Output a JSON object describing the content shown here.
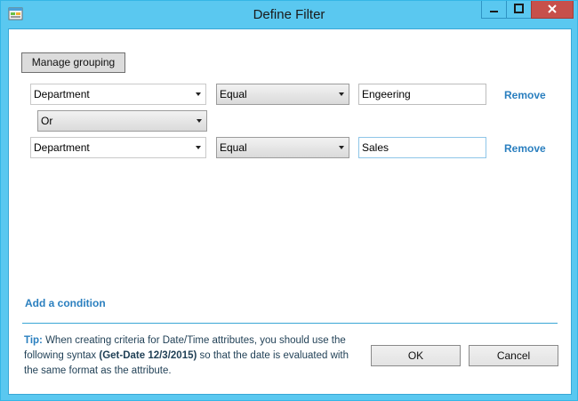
{
  "window": {
    "title": "Define Filter",
    "icon": "filter-app-icon",
    "controls": [
      "minimize-icon",
      "maximize-icon",
      "close-icon"
    ]
  },
  "toolbar": {
    "manage_grouping_label": "Manage grouping"
  },
  "conditions": [
    {
      "attribute": "Department",
      "operator": "Equal",
      "value": "Engeering",
      "remove_label": "Remove"
    },
    {
      "attribute": "Department",
      "operator": "Equal",
      "value": "Sales",
      "remove_label": "Remove"
    }
  ],
  "group_operator": "Or",
  "add_condition_label": "Add a condition",
  "tip": {
    "label": "Tip:",
    "text_before": " When creating criteria for Date/Time attributes, you should use the following syntax ",
    "syntax": "(Get-Date 12/3/2015)",
    "text_after": " so that the date is evaluated with the same format as the attribute."
  },
  "footer": {
    "ok_label": "OK",
    "cancel_label": "Cancel"
  },
  "colors": {
    "titlebar": "#5ac8f0",
    "close_button": "#c7504b",
    "link": "#2a7fbf",
    "divider": "#3aa7d6"
  }
}
